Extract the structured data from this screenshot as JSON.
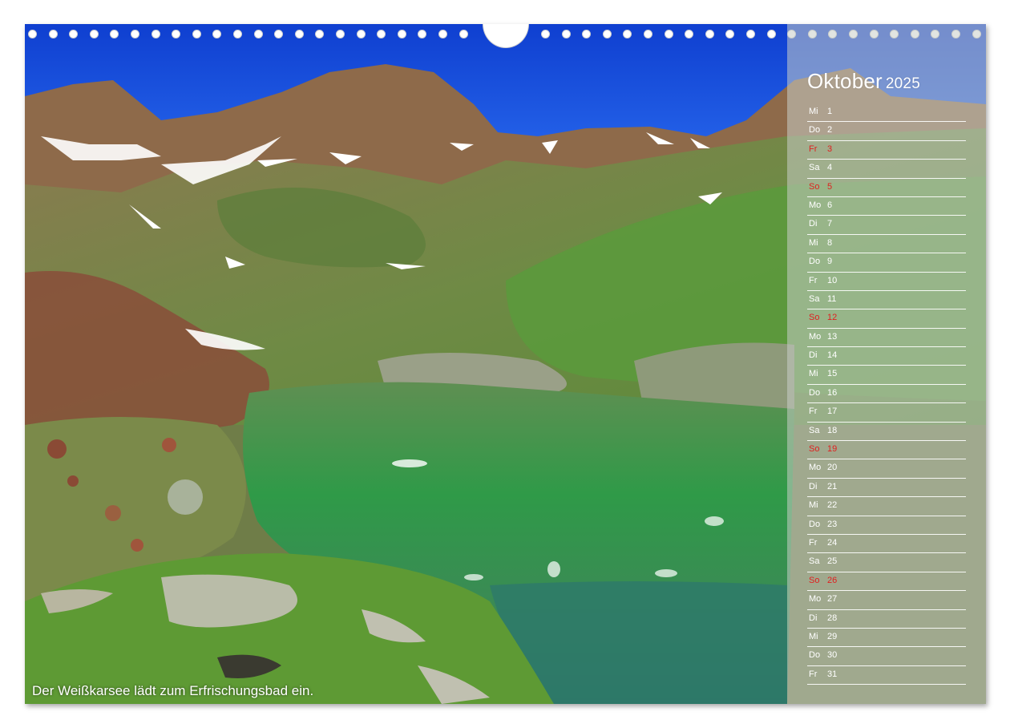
{
  "calendar": {
    "month": "Oktober",
    "year": "2025",
    "caption": "Der Weißkarsee lädt zum Erfrischungsbad ein.",
    "days": [
      {
        "weekday": "Mi",
        "day": "1",
        "type": "normal"
      },
      {
        "weekday": "Do",
        "day": "2",
        "type": "normal"
      },
      {
        "weekday": "Fr",
        "day": "3",
        "type": "holiday"
      },
      {
        "weekday": "Sa",
        "day": "4",
        "type": "normal"
      },
      {
        "weekday": "So",
        "day": "5",
        "type": "sunday"
      },
      {
        "weekday": "Mo",
        "day": "6",
        "type": "normal"
      },
      {
        "weekday": "Di",
        "day": "7",
        "type": "normal"
      },
      {
        "weekday": "Mi",
        "day": "8",
        "type": "normal"
      },
      {
        "weekday": "Do",
        "day": "9",
        "type": "normal"
      },
      {
        "weekday": "Fr",
        "day": "10",
        "type": "normal"
      },
      {
        "weekday": "Sa",
        "day": "11",
        "type": "normal"
      },
      {
        "weekday": "So",
        "day": "12",
        "type": "sunday"
      },
      {
        "weekday": "Mo",
        "day": "13",
        "type": "normal"
      },
      {
        "weekday": "Di",
        "day": "14",
        "type": "normal"
      },
      {
        "weekday": "Mi",
        "day": "15",
        "type": "normal"
      },
      {
        "weekday": "Do",
        "day": "16",
        "type": "normal"
      },
      {
        "weekday": "Fr",
        "day": "17",
        "type": "normal"
      },
      {
        "weekday": "Sa",
        "day": "18",
        "type": "normal"
      },
      {
        "weekday": "So",
        "day": "19",
        "type": "sunday"
      },
      {
        "weekday": "Mo",
        "day": "20",
        "type": "normal"
      },
      {
        "weekday": "Di",
        "day": "21",
        "type": "normal"
      },
      {
        "weekday": "Mi",
        "day": "22",
        "type": "normal"
      },
      {
        "weekday": "Do",
        "day": "23",
        "type": "normal"
      },
      {
        "weekday": "Fr",
        "day": "24",
        "type": "normal"
      },
      {
        "weekday": "Sa",
        "day": "25",
        "type": "normal"
      },
      {
        "weekday": "So",
        "day": "26",
        "type": "sunday"
      },
      {
        "weekday": "Mo",
        "day": "27",
        "type": "normal"
      },
      {
        "weekday": "Di",
        "day": "28",
        "type": "normal"
      },
      {
        "weekday": "Mi",
        "day": "29",
        "type": "normal"
      },
      {
        "weekday": "Do",
        "day": "30",
        "type": "normal"
      },
      {
        "weekday": "Fr",
        "day": "31",
        "type": "normal"
      }
    ]
  },
  "colors": {
    "sky": "#1550d8",
    "sunday_red": "#e02020",
    "lake_green": "#3f9a4a",
    "grass": "#6aa83a"
  }
}
